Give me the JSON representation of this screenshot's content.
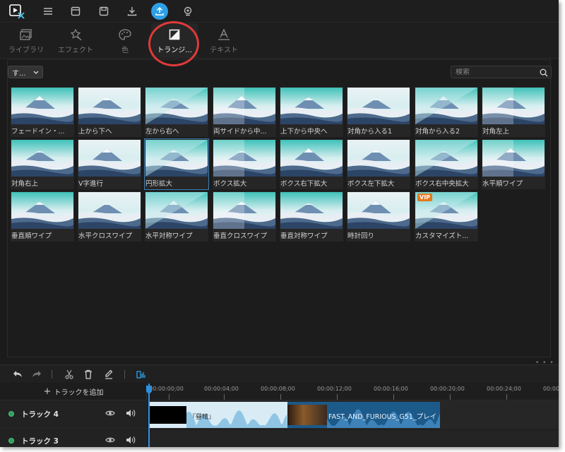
{
  "tabs": [
    {
      "label": "ライブラリ"
    },
    {
      "label": "エフェクト"
    },
    {
      "label": "色"
    },
    {
      "label": "トランジ..."
    },
    {
      "label": "テキスト"
    }
  ],
  "filter": {
    "value": "す..."
  },
  "search": {
    "placeholder": "検索"
  },
  "transitions": [
    {
      "label": "フェードイン・..."
    },
    {
      "label": "上から下へ"
    },
    {
      "label": "左から右へ"
    },
    {
      "label": "両サイドから中..."
    },
    {
      "label": "上下から中央へ"
    },
    {
      "label": "対角から入る1"
    },
    {
      "label": "対角から入る2"
    },
    {
      "label": "対角左上"
    },
    {
      "label": "対角右上"
    },
    {
      "label": "V字進行"
    },
    {
      "label": "円形拡大"
    },
    {
      "label": "ボクス拡大"
    },
    {
      "label": "ボクス右下拡大"
    },
    {
      "label": "ボクス左下拡大"
    },
    {
      "label": "ボクス右中央拡大"
    },
    {
      "label": "水平順ワイプ"
    },
    {
      "label": "垂直順ワイプ"
    },
    {
      "label": "水平クロスワイプ"
    },
    {
      "label": "水平対称ワイプ"
    },
    {
      "label": "垂直クロスワイプ"
    },
    {
      "label": "垂直対称ワイプ"
    },
    {
      "label": "時計回り"
    },
    {
      "label": "カスタマイズト...",
      "badge": "VIP"
    }
  ],
  "timeline": {
    "add_track": "トラックを追加",
    "ruler": [
      "00:00:00;00",
      "00:00:04;00",
      "00:00:08;00",
      "00:00:12;00",
      "00:00:16;00",
      "00:00:20;00",
      "00:00:24;00",
      "00:00"
    ],
    "tracks": [
      {
        "name": "トラック 4"
      },
      {
        "name": "トラック 3"
      }
    ],
    "clips": [
      {
        "label": "『昼晴』"
      },
      {
        "label": "FAST_AND_FURIOUS_G51_プレイ"
      }
    ]
  },
  "colors": {
    "accent": "#2ea0e8",
    "highlight_circle": "#e03a3a",
    "vip": "#e6781e"
  }
}
